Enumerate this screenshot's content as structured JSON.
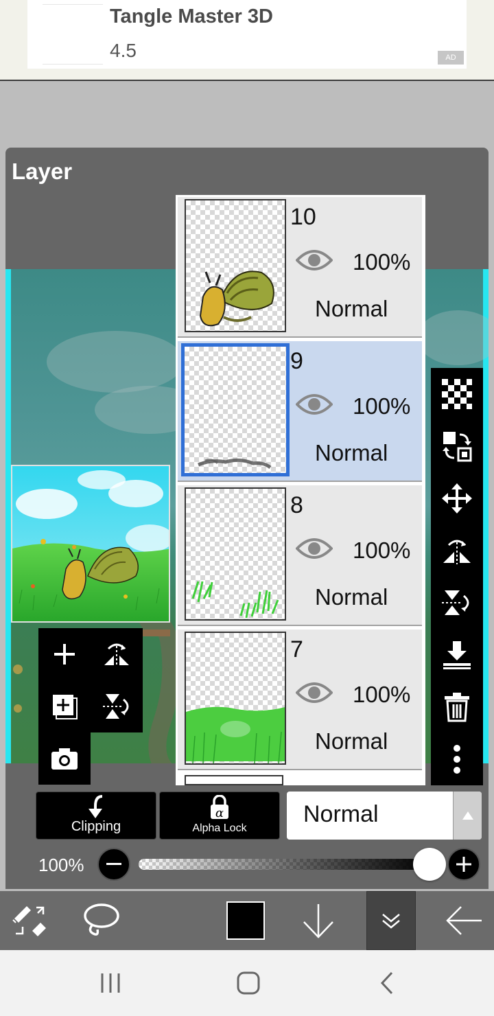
{
  "ad": {
    "title": "Tangle Master 3D",
    "rating": "4.5",
    "badge": "AD"
  },
  "panel": {
    "title": "Layer"
  },
  "layers": [
    {
      "number": "10",
      "opacity": "100%",
      "mode": "Normal",
      "selected": false
    },
    {
      "number": "9",
      "opacity": "100%",
      "mode": "Normal",
      "selected": true
    },
    {
      "number": "8",
      "opacity": "100%",
      "mode": "Normal",
      "selected": false
    },
    {
      "number": "7",
      "opacity": "100%",
      "mode": "Normal",
      "selected": false
    }
  ],
  "left_tools": [
    "add-layer-icon",
    "flip-horizontal-icon",
    "add-copy-layer-icon",
    "flip-vertical-icon",
    "camera-icon"
  ],
  "right_tools": [
    "transparency-checker-icon",
    "swap-layer-icon",
    "move-icon",
    "flip-horizontal-icon",
    "flip-vertical-icon",
    "merge-down-icon",
    "trash-icon",
    "more-icon"
  ],
  "controls": {
    "clipping_label": "Clipping",
    "alpha_lock_label": "Alpha Lock",
    "alpha_symbol": "α",
    "blend_mode": "Normal",
    "opacity_label": "100%",
    "opacity_value": 1.0
  },
  "toolbar": {
    "items": [
      "transform-tool-icon",
      "lasso-icon",
      "color-swatch",
      "arrow-down-icon",
      "double-chevron-down-icon",
      "back-arrow-icon"
    ],
    "current_color": "#000000"
  },
  "colors": {
    "accent_selected": "#2f6fd6",
    "selected_row": "#c9d8ee",
    "panel_bg": "#666666"
  }
}
